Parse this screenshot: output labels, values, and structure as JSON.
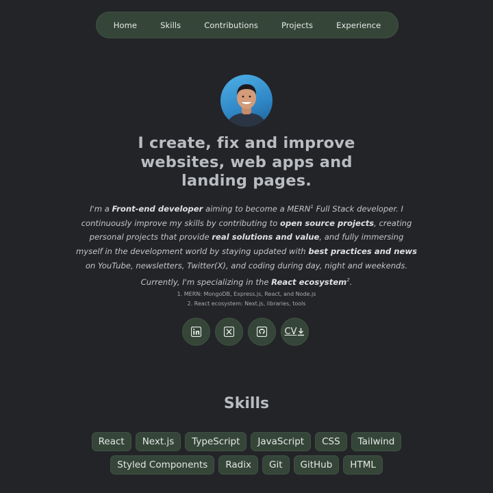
{
  "nav": {
    "items": [
      "Home",
      "Skills",
      "Contributions",
      "Projects",
      "Experience"
    ]
  },
  "hero": {
    "headline": [
      "I create, fix and improve",
      "websites, web apps and",
      "landing pages."
    ],
    "intro": {
      "p1": "I'm a ",
      "b1": "Front-end developer",
      "p2": " aiming to become a MERN",
      "sup1": "1",
      "p3": " Full Stack developer. I continuously improve my skills by contributing to ",
      "b2": "open source projects",
      "p4": ", creating personal projects that provide ",
      "b3": "real solutions and value",
      "p5": ", and fully immersing myself in the development world by staying updated with ",
      "b4": "best practices and news",
      "p6": " on YouTube, newsletters, Twitter(X), and coding during day, night and weekends. Currently, I'm specializing in the ",
      "b5": "React ecosystem",
      "sup2": "2",
      "p7": "."
    },
    "notes": [
      "1. MERN: MongoDB, Express.js, React, and Node.js",
      "2. React ecosystem: Next.js, libraries, tools"
    ]
  },
  "social": {
    "linkedin": "linkedin-icon",
    "x": "x-icon",
    "github": "github-icon",
    "cv_label": "CV"
  },
  "skills": {
    "title": "Skills",
    "items": [
      "React",
      "Next.js",
      "TypeScript",
      "JavaScript",
      "CSS",
      "Tailwind",
      "Styled Components",
      "Radix",
      "Git",
      "GitHub",
      "HTML"
    ]
  },
  "colors": {
    "background": "#232428",
    "accent": "#354638"
  }
}
